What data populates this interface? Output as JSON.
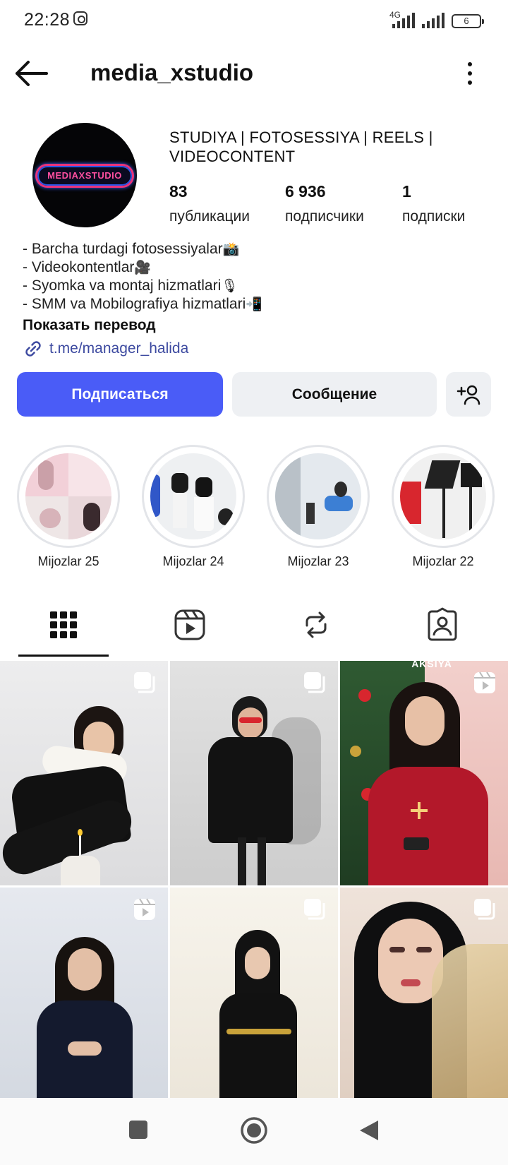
{
  "status_bar": {
    "time": "22:28",
    "network": "4G",
    "battery": "6",
    "icons": [
      "instagram-icon",
      "signal-icon",
      "battery-icon"
    ]
  },
  "header": {
    "username": "media_xstudio",
    "back_icon": "arrow-left-icon",
    "menu_icon": "more-vertical-icon"
  },
  "profile": {
    "avatar_text": "MEDIAXSTUDIO",
    "name": "STUDIYA | FOTOSESSIYA | REELS | VIDEOCONTENT",
    "stats": [
      {
        "value": "83",
        "label": "публикации"
      },
      {
        "value": "6 936",
        "label": "подписчики"
      },
      {
        "value": "1",
        "label": "подписки"
      }
    ]
  },
  "bio": {
    "lines": [
      {
        "text": "- Barcha turdagi fotosessiyalar",
        "emoji": "📸"
      },
      {
        "text": "- Videokontentlar",
        "emoji": "🎥"
      },
      {
        "text": "- Syomka va montaj hizmatlari",
        "emoji": "🎙"
      },
      {
        "text": "- SMM va Mobilografiya hizmatlari",
        "emoji": "📲"
      }
    ],
    "translate_label": "Показать перевод",
    "link": "t.me/manager_halida"
  },
  "actions": {
    "follow_label": "Подписаться",
    "message_label": "Сообщение",
    "follow_color": "#4a5cf7"
  },
  "highlights": [
    {
      "label": "Mijozlar 25"
    },
    {
      "label": "Mijozlar 24"
    },
    {
      "label": "Mijozlar 23"
    },
    {
      "label": "Mijozlar 22"
    }
  ],
  "tabs": [
    {
      "name": "grid",
      "icon": "grid-icon",
      "active": true
    },
    {
      "name": "reels",
      "icon": "reels-icon",
      "active": false
    },
    {
      "name": "reposts",
      "icon": "repost-icon",
      "active": false
    },
    {
      "name": "tagged",
      "icon": "tagged-icon",
      "active": false
    }
  ],
  "grid_posts": [
    {
      "type": "carousel"
    },
    {
      "type": "carousel"
    },
    {
      "type": "reel",
      "overlay_text": "AKSIYA"
    },
    {
      "type": "reel"
    },
    {
      "type": "carousel"
    },
    {
      "type": "carousel"
    }
  ],
  "nav_bar": {
    "icons": [
      "recents-icon",
      "home-icon",
      "back-icon"
    ]
  }
}
